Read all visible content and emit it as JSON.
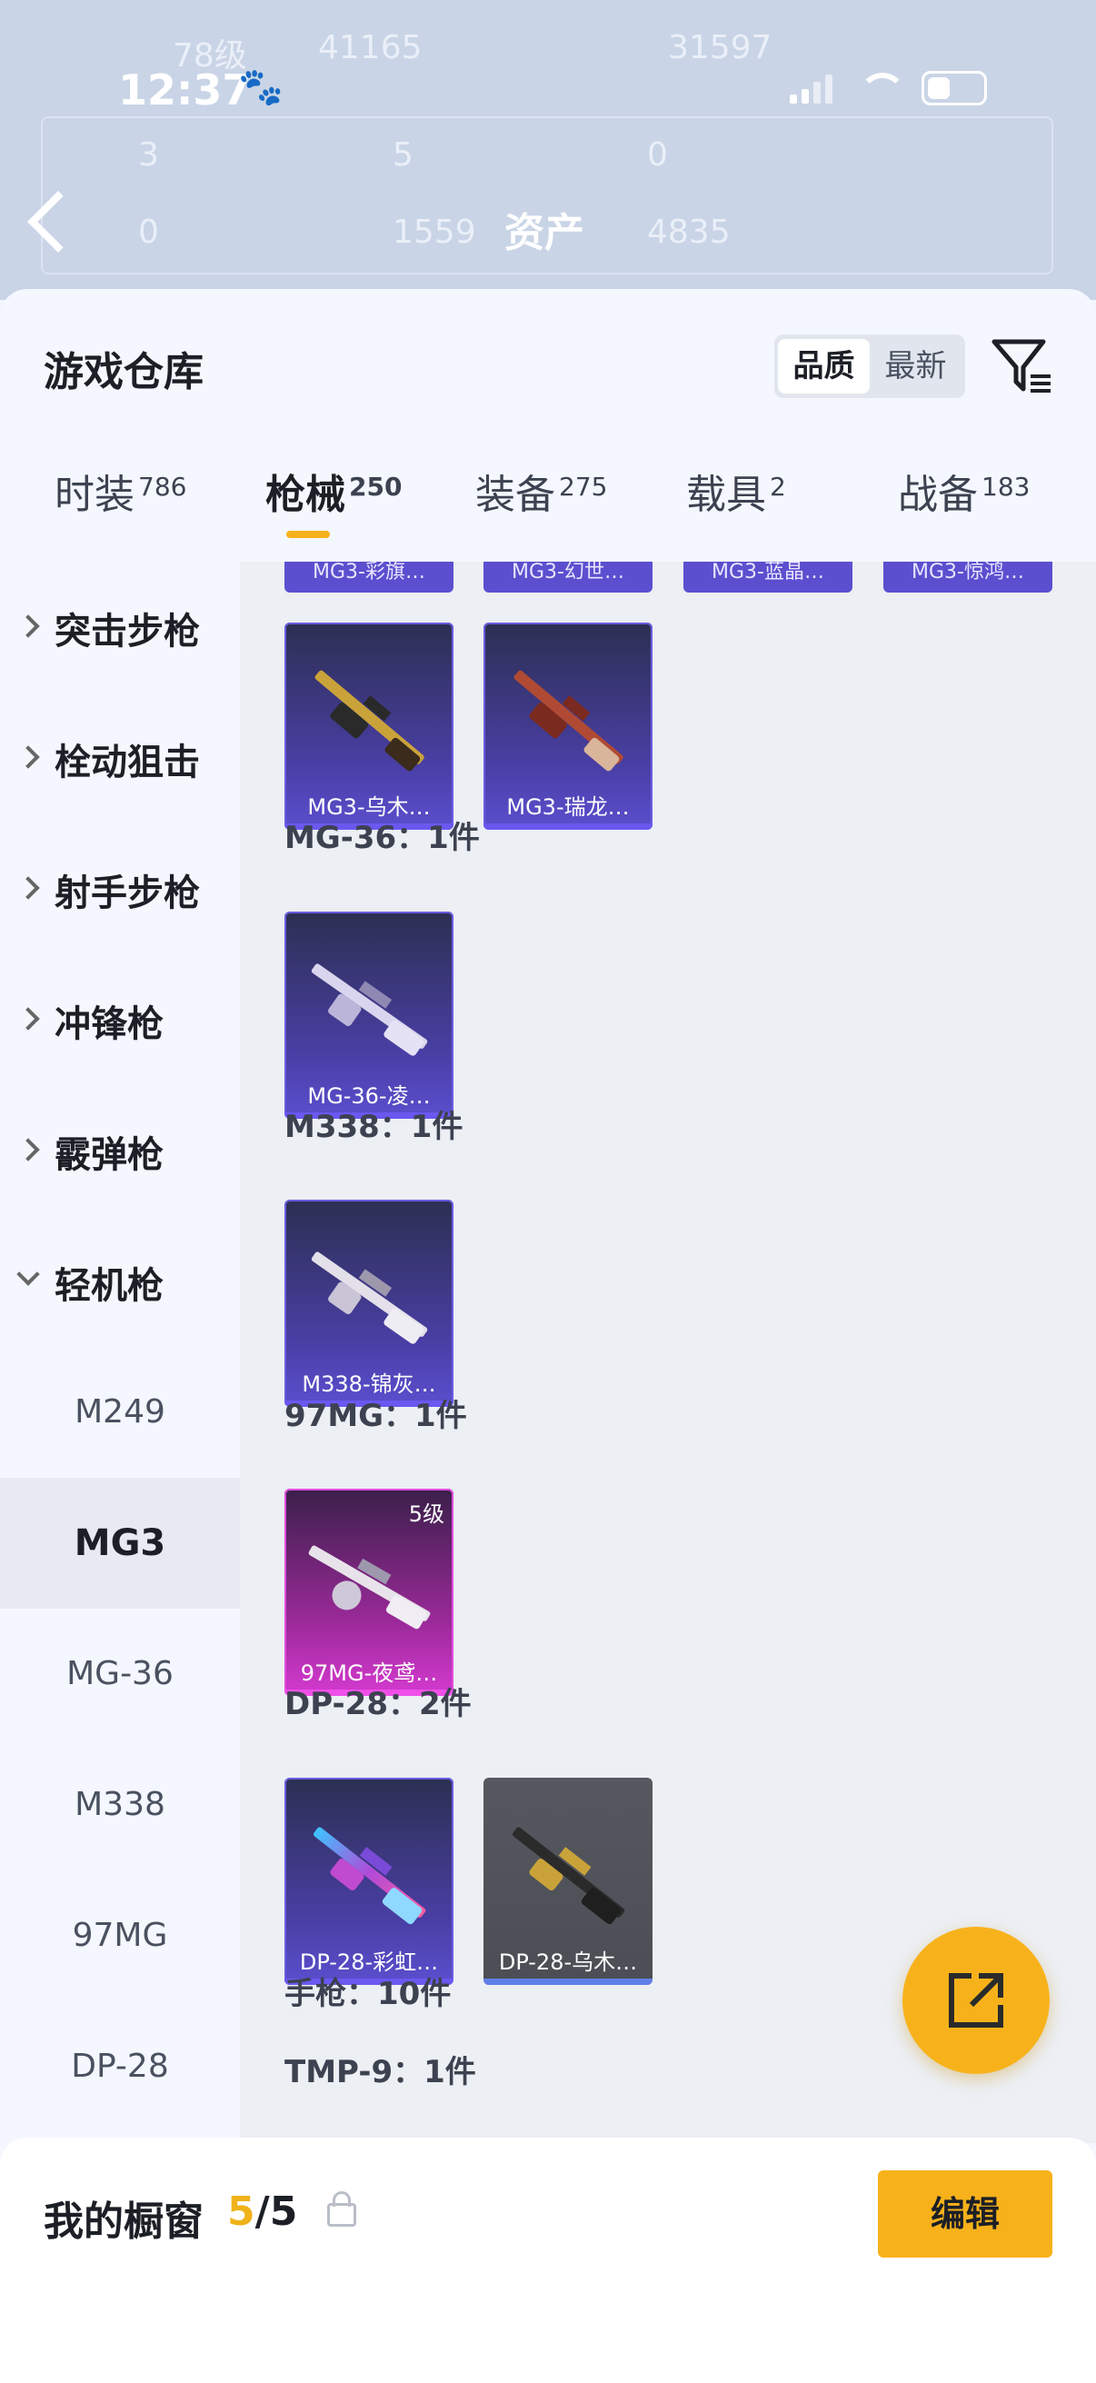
{
  "status_bar": {
    "time": "12:37",
    "paw": "🐾"
  },
  "background_header": {
    "level": "78级",
    "visits": "41165",
    "score": "31597",
    "stat_a": "3",
    "stat_b": "5",
    "stat_c": "0",
    "stat_d": "0",
    "stat_e": "1559",
    "stat_f": "4835",
    "title": "资产"
  },
  "sheet": {
    "title": "游戏仓库",
    "sort_options": [
      "品质",
      "最新"
    ],
    "sort_active": "品质"
  },
  "tabs": [
    {
      "label": "时装",
      "count": "786"
    },
    {
      "label": "枪械",
      "count": "250",
      "active": true
    },
    {
      "label": "装备",
      "count": "275"
    },
    {
      "label": "载具",
      "count": "2"
    },
    {
      "label": "战备",
      "count": "183"
    }
  ],
  "categories": [
    {
      "label": "突击步枪",
      "expanded": false
    },
    {
      "label": "栓动狙击",
      "expanded": false
    },
    {
      "label": "射手步枪",
      "expanded": false
    },
    {
      "label": "冲锋枪",
      "expanded": false
    },
    {
      "label": "霰弹枪",
      "expanded": false
    },
    {
      "label": "轻机枪",
      "expanded": true
    }
  ],
  "subcategories": [
    "M249",
    "MG3",
    "MG-36",
    "M338",
    "97MG",
    "DP-28"
  ],
  "subcategory_active": "MG3",
  "partial_top_cards": [
    "MG3-彩旗…",
    "MG3-幻世…",
    "MG3-蓝晶…",
    "MG3-惊鸿…"
  ],
  "sections": [
    {
      "title": "",
      "items": [
        {
          "name": "MG3-乌木…",
          "style": "purple"
        },
        {
          "name": "MG3-瑞龙…",
          "style": "purple"
        }
      ]
    },
    {
      "title": "MG-36：1件",
      "items": [
        {
          "name": "MG-36-凌…",
          "style": "purple"
        }
      ]
    },
    {
      "title": "M338：1件",
      "items": [
        {
          "name": "M338-锦灰…",
          "style": "purple"
        }
      ]
    },
    {
      "title": "97MG：1件",
      "items": [
        {
          "name": "97MG-夜鸢…",
          "style": "pink",
          "badge": "5级"
        }
      ]
    },
    {
      "title": "DP-28：2件",
      "items": [
        {
          "name": "DP-28-彩虹…",
          "style": "purple"
        },
        {
          "name": "DP-28-乌木…",
          "style": "grey"
        }
      ]
    },
    {
      "title": "手枪：10件",
      "items": []
    },
    {
      "title": "TMP-9：1件",
      "items": []
    }
  ],
  "bottom": {
    "title": "我的橱窗",
    "current": "5",
    "total": "/5",
    "edit_label": "编辑"
  },
  "colors": {
    "accent": "#f7b21b",
    "card_purple": "#5b4fcf",
    "card_pink": "#d53ad0"
  }
}
